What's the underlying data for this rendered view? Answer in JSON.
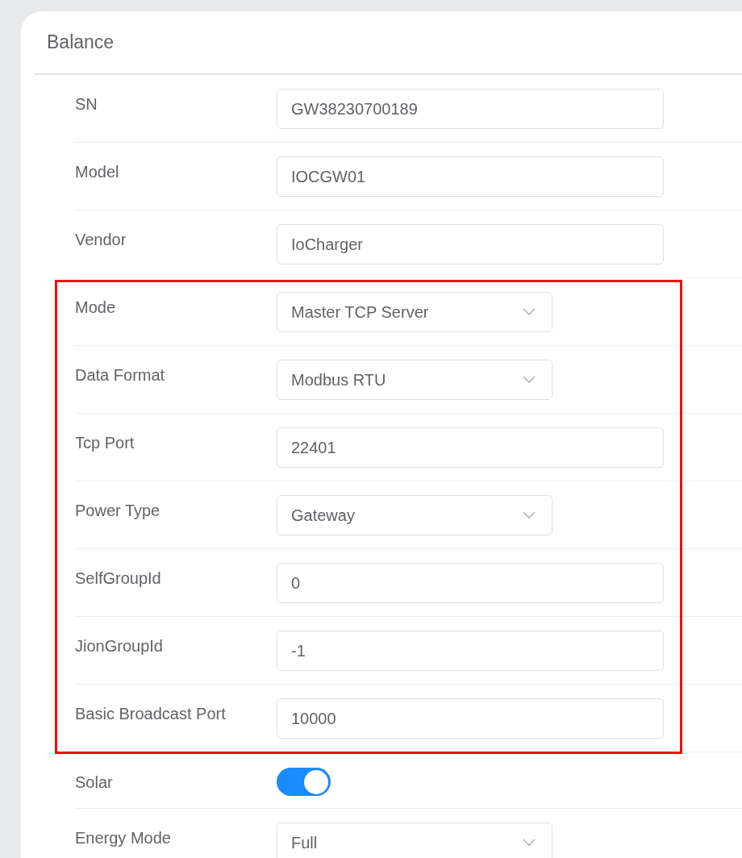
{
  "panel": {
    "title": "Balance"
  },
  "sections": [
    {
      "highlighted": false,
      "rows": [
        {
          "label": "SN",
          "kind": "text",
          "value": "GW38230700189"
        },
        {
          "label": "Model",
          "kind": "text",
          "value": "IOCGW01"
        },
        {
          "label": "Vendor",
          "kind": "text",
          "value": "IoCharger"
        }
      ]
    },
    {
      "highlighted": true,
      "rows": [
        {
          "label": "Mode",
          "kind": "select",
          "value": "Master TCP Server"
        },
        {
          "label": "Data Format",
          "kind": "select",
          "value": "Modbus RTU"
        },
        {
          "label": "Tcp Port",
          "kind": "text",
          "value": "22401"
        },
        {
          "label": "Power Type",
          "kind": "select",
          "value": "Gateway"
        },
        {
          "label": "SelfGroupId",
          "kind": "text",
          "value": "0"
        },
        {
          "label": "JionGroupId",
          "kind": "text",
          "value": "-1"
        },
        {
          "label": "Basic Broadcast Port",
          "kind": "text",
          "value": "10000"
        }
      ]
    },
    {
      "highlighted": false,
      "rows": [
        {
          "label": "Solar",
          "kind": "switch",
          "on": true
        },
        {
          "label": "Energy Mode",
          "kind": "select",
          "value": "Full"
        }
      ]
    }
  ]
}
